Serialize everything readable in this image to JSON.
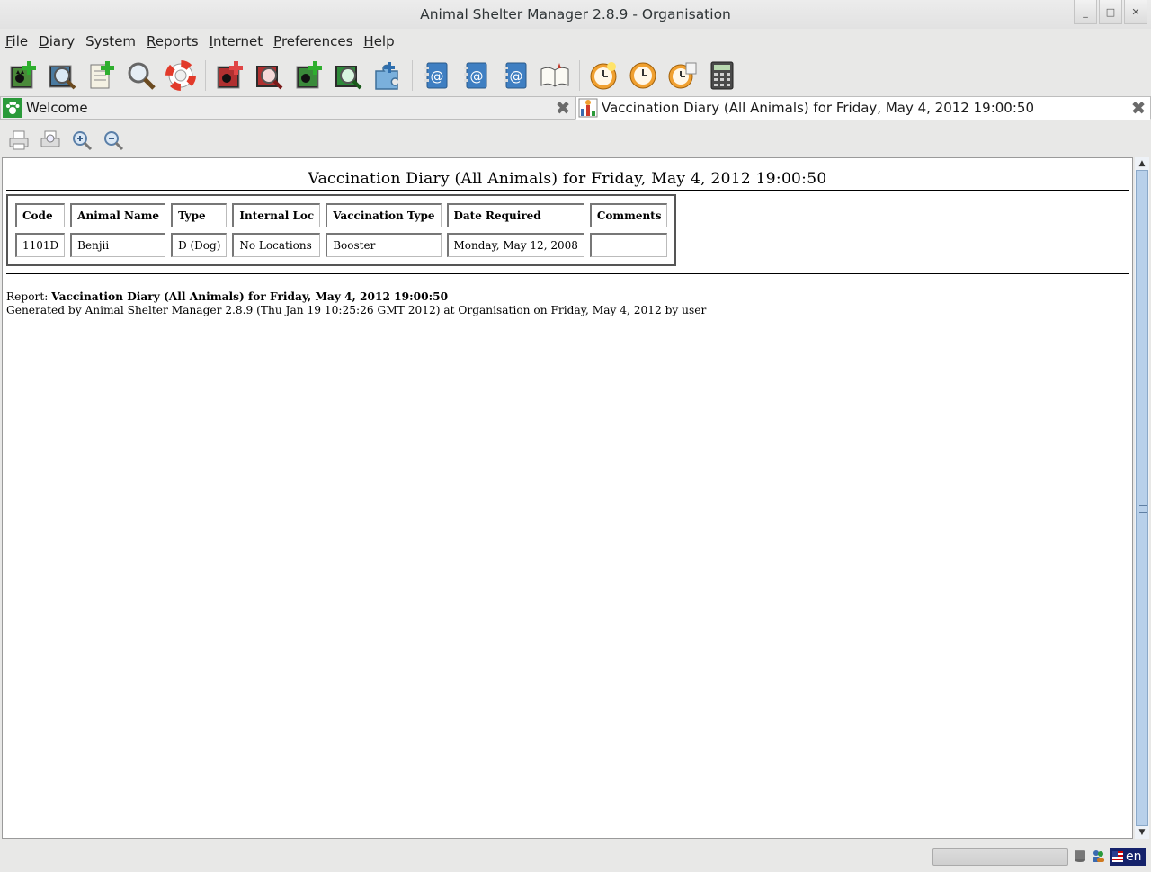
{
  "window": {
    "title": "Animal Shelter Manager 2.8.9 - Organisation",
    "controls": [
      "minimize",
      "maximize",
      "close"
    ]
  },
  "menu": [
    {
      "mnemonic": "F",
      "rest": "ile"
    },
    {
      "mnemonic": "D",
      "rest": "iary"
    },
    {
      "mnemonic": "",
      "rest": "System"
    },
    {
      "mnemonic": "R",
      "rest": "eports"
    },
    {
      "mnemonic": "I",
      "rest": "nternet"
    },
    {
      "mnemonic": "P",
      "rest": "references"
    },
    {
      "mnemonic": "H",
      "rest": "elp"
    }
  ],
  "toolbar_icons": [
    "add-animal-icon",
    "find-animal-icon",
    "add-owner-icon",
    "find-owner-icon",
    "lifebuoy-icon",
    "add-lost-animal-icon",
    "find-lost-animal-icon",
    "add-found-animal-icon",
    "find-found-animal-icon",
    "match-lost-found-icon",
    "address-book-icon",
    "address-book-2-icon",
    "address-book-3-icon",
    "book-icon",
    "diary-clock-icon",
    "clock-icon",
    "clock-tasks-icon",
    "calculator-icon"
  ],
  "tabs": [
    {
      "label": "Welcome",
      "icon": "paw-icon",
      "active": false
    },
    {
      "label": "Vaccination Diary (All Animals) for Friday, May 4, 2012 19:00:50",
      "icon": "report-icon",
      "active": true
    }
  ],
  "report_toolbar": [
    "print-icon",
    "print-preview-icon",
    "zoom-in-icon",
    "zoom-out-icon"
  ],
  "report": {
    "title": "Vaccination Diary (All Animals) for Friday, May 4, 2012 19:00:50",
    "columns": [
      "Code",
      "Animal Name",
      "Type",
      "Internal Loc",
      "Vaccination Type",
      "Date Required",
      "Comments"
    ],
    "rows": [
      [
        "1101D",
        "Benjii",
        "D (Dog)",
        "No Locations",
        "Booster",
        "Monday, May 12, 2008",
        ""
      ]
    ],
    "footer_label": "Report:",
    "footer_report": "Vaccination Diary (All Animals) for Friday, May 4, 2012 19:00:50",
    "footer_generated": "Generated by Animal Shelter Manager 2.8.9 (Thu Jan 19 10:25:26 GMT 2012) at Organisation on Friday, May 4, 2012 by user"
  },
  "status": {
    "language": "en"
  }
}
